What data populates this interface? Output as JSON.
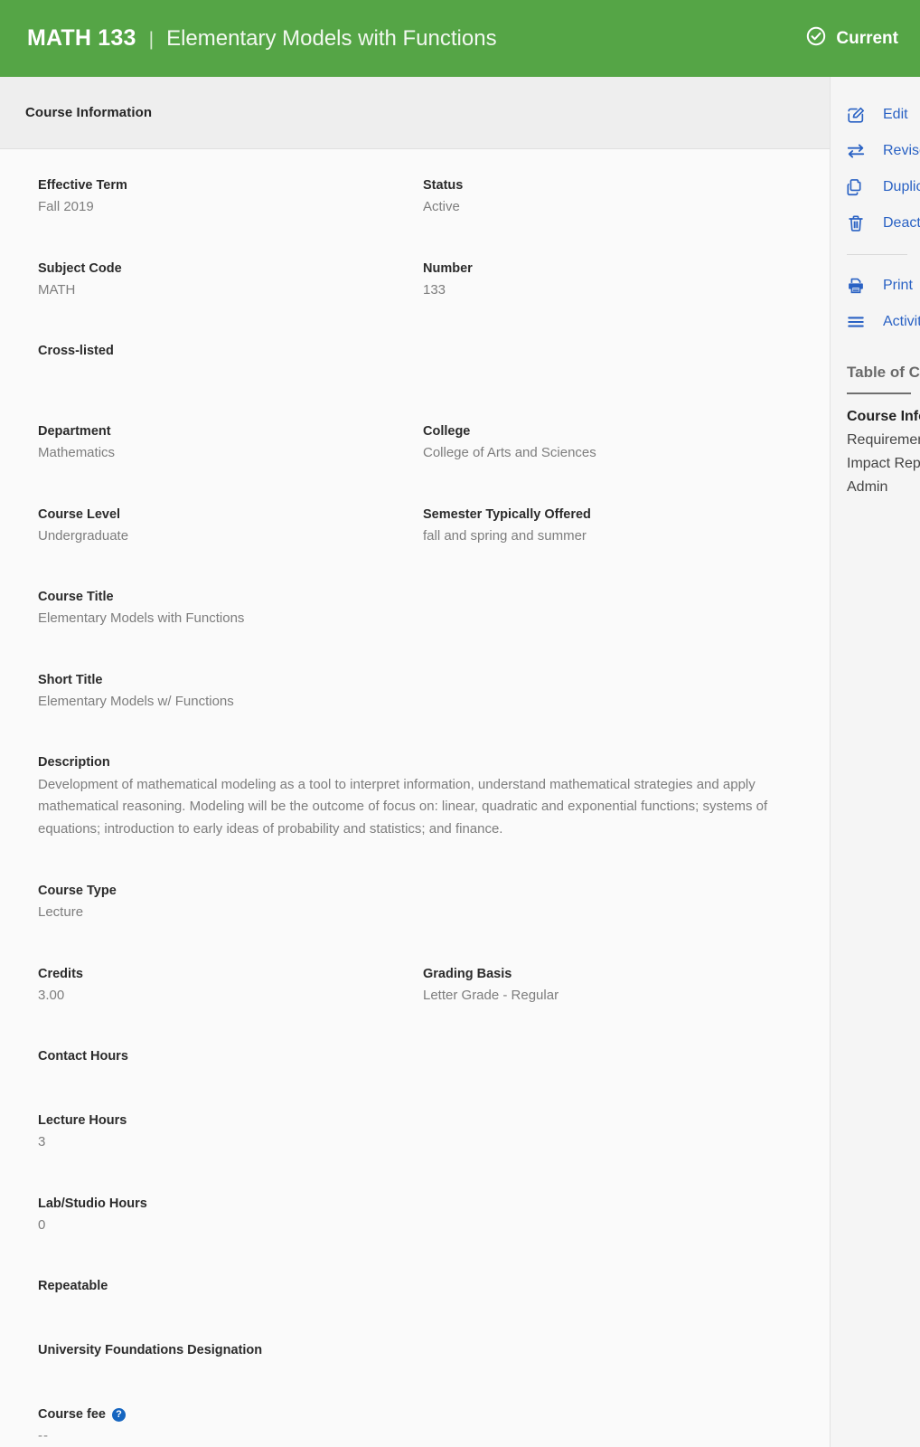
{
  "header": {
    "course_code": "MATH 133",
    "separator": "|",
    "course_name": "Elementary Models with Functions",
    "status_label": "Current",
    "status_icon": "check-circle-icon",
    "background_color": "#55a546"
  },
  "section_strip": {
    "title": "Course Information"
  },
  "fields": {
    "effective_term": {
      "label": "Effective Term",
      "value": "Fall 2019"
    },
    "status": {
      "label": "Status",
      "value": "Active"
    },
    "subject_code": {
      "label": "Subject Code",
      "value": "MATH"
    },
    "number": {
      "label": "Number",
      "value": "133"
    },
    "cross_listed": {
      "label": "Cross-listed",
      "value": ""
    },
    "department": {
      "label": "Department",
      "value": "Mathematics"
    },
    "college": {
      "label": "College",
      "value": "College of Arts and Sciences"
    },
    "course_level": {
      "label": "Course Level",
      "value": "Undergraduate"
    },
    "semester_offered": {
      "label": "Semester Typically Offered",
      "value": "fall and spring and summer"
    },
    "course_title": {
      "label": "Course Title",
      "value": "Elementary Models with Functions"
    },
    "short_title": {
      "label": "Short Title",
      "value": "Elementary Models w/ Functions"
    },
    "description": {
      "label": "Description",
      "value": "Development of mathematical modeling as a tool to interpret information, understand mathematical strategies and apply mathematical reasoning. Modeling will be the outcome of focus on: linear, quadratic and exponential functions; systems of equations; introduction to early ideas of probability and statistics; and finance."
    },
    "course_type": {
      "label": "Course Type",
      "value": "Lecture"
    },
    "credits": {
      "label": "Credits",
      "value": "3.00"
    },
    "grading_basis": {
      "label": "Grading Basis",
      "value": "Letter Grade - Regular"
    },
    "contact_hours": {
      "label": "Contact Hours",
      "value": ""
    },
    "lecture_hours": {
      "label": "Lecture Hours",
      "value": "3"
    },
    "lab_studio_hours": {
      "label": "Lab/Studio Hours",
      "value": "0"
    },
    "repeatable": {
      "label": "Repeatable",
      "value": ""
    },
    "university_foundations": {
      "label": "University Foundations Designation",
      "value": ""
    },
    "course_fee": {
      "label": "Course fee",
      "help_icon": "?",
      "value": "--"
    }
  },
  "side_panel": {
    "actions": [
      {
        "icon": "edit-icon",
        "label": "Edit"
      },
      {
        "icon": "transfer-arrows-icon",
        "label": "Revise"
      },
      {
        "icon": "duplicate-icon",
        "label": "Duplicate"
      },
      {
        "icon": "trash-icon",
        "label": "Deactivate"
      },
      {
        "icon": "printer-icon",
        "label": "Print"
      },
      {
        "icon": "list-lines-icon",
        "label": "Activity"
      }
    ],
    "toc_title": "Table of Contents",
    "toc_items": [
      {
        "label": "Course Information",
        "active": true
      },
      {
        "label": "Requirements",
        "active": false
      },
      {
        "label": "Impact Report",
        "active": false
      },
      {
        "label": "Admin",
        "active": false
      }
    ]
  }
}
